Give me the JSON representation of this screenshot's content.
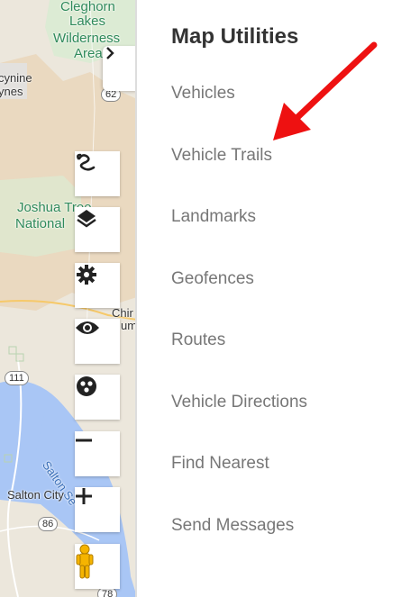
{
  "map": {
    "labels": {
      "cleghorn": "Cleghorn",
      "lakes": "Lakes",
      "wilderness": "Wilderness",
      "area": "Area",
      "yucca": "cynine",
      "yucca2": "ynes",
      "joshua": "Joshua Tree",
      "national": "National",
      "chir": "Chir",
      "um": "um",
      "salton_sea": "Salton Se",
      "salton_city": "Salton City"
    },
    "shields": {
      "r62": "62",
      "r111": "111",
      "r86": "86",
      "r78": "78"
    },
    "colors": {
      "land": "#e9e4d8",
      "park": "#d9ecd3",
      "desert": "#ead9c0",
      "water": "#a9c6f5"
    }
  },
  "controls": {
    "expand_icon": "chevron-right-icon",
    "buttons": [
      {
        "name": "trails-control-button",
        "icon": "route-icon"
      },
      {
        "name": "layers-control-button",
        "icon": "layers-icon"
      },
      {
        "name": "settings-control-button",
        "icon": "gear-icon"
      },
      {
        "name": "visibility-control-button",
        "icon": "eye-icon"
      },
      {
        "name": "cluster-control-button",
        "icon": "cluster-icon"
      },
      {
        "name": "zoom-out-button",
        "icon": "minus-icon"
      },
      {
        "name": "zoom-in-button",
        "icon": "plus-icon"
      },
      {
        "name": "street-view-button",
        "icon": "pegman-icon"
      }
    ]
  },
  "panel": {
    "title": "Map Utilities",
    "items": [
      {
        "label": "Vehicles"
      },
      {
        "label": "Vehicle Trails"
      },
      {
        "label": "Landmarks"
      },
      {
        "label": "Geofences"
      },
      {
        "label": "Routes"
      },
      {
        "label": "Vehicle Directions"
      },
      {
        "label": "Find Nearest"
      },
      {
        "label": "Send Messages"
      }
    ],
    "annotation_color": "#ee1111"
  }
}
